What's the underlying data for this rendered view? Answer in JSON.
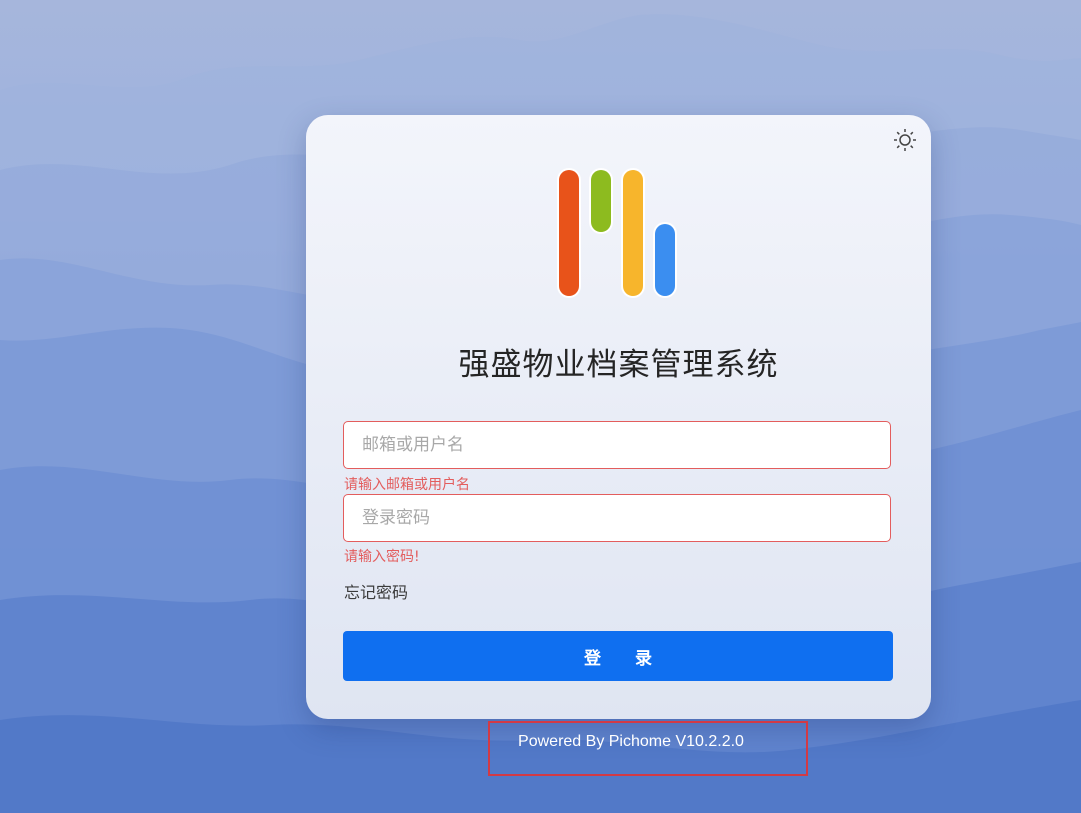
{
  "app": {
    "title": "强盛物业档案管理系统"
  },
  "form": {
    "username_placeholder": "邮箱或用户名",
    "username_value": "",
    "username_error": "请输入邮箱或用户名",
    "password_placeholder": "登录密码",
    "password_value": "",
    "password_error": "请输入密码!",
    "forgot_label": "忘记密码",
    "login_label": "登 录"
  },
  "footer": {
    "powered_by": "Powered By Pichome V10.2.2.0"
  },
  "icons": {
    "theme_toggle": "sun-icon",
    "logo": "pichome-logo"
  },
  "colors": {
    "primary": "#0f6ff0",
    "error": "#e35d5d",
    "logo_bar_1": "#e8531a",
    "logo_bar_2": "#8dbb1f",
    "logo_bar_3": "#f7b52c",
    "logo_bar_4": "#3b8ef0",
    "annotation_box": "#d23a45"
  }
}
